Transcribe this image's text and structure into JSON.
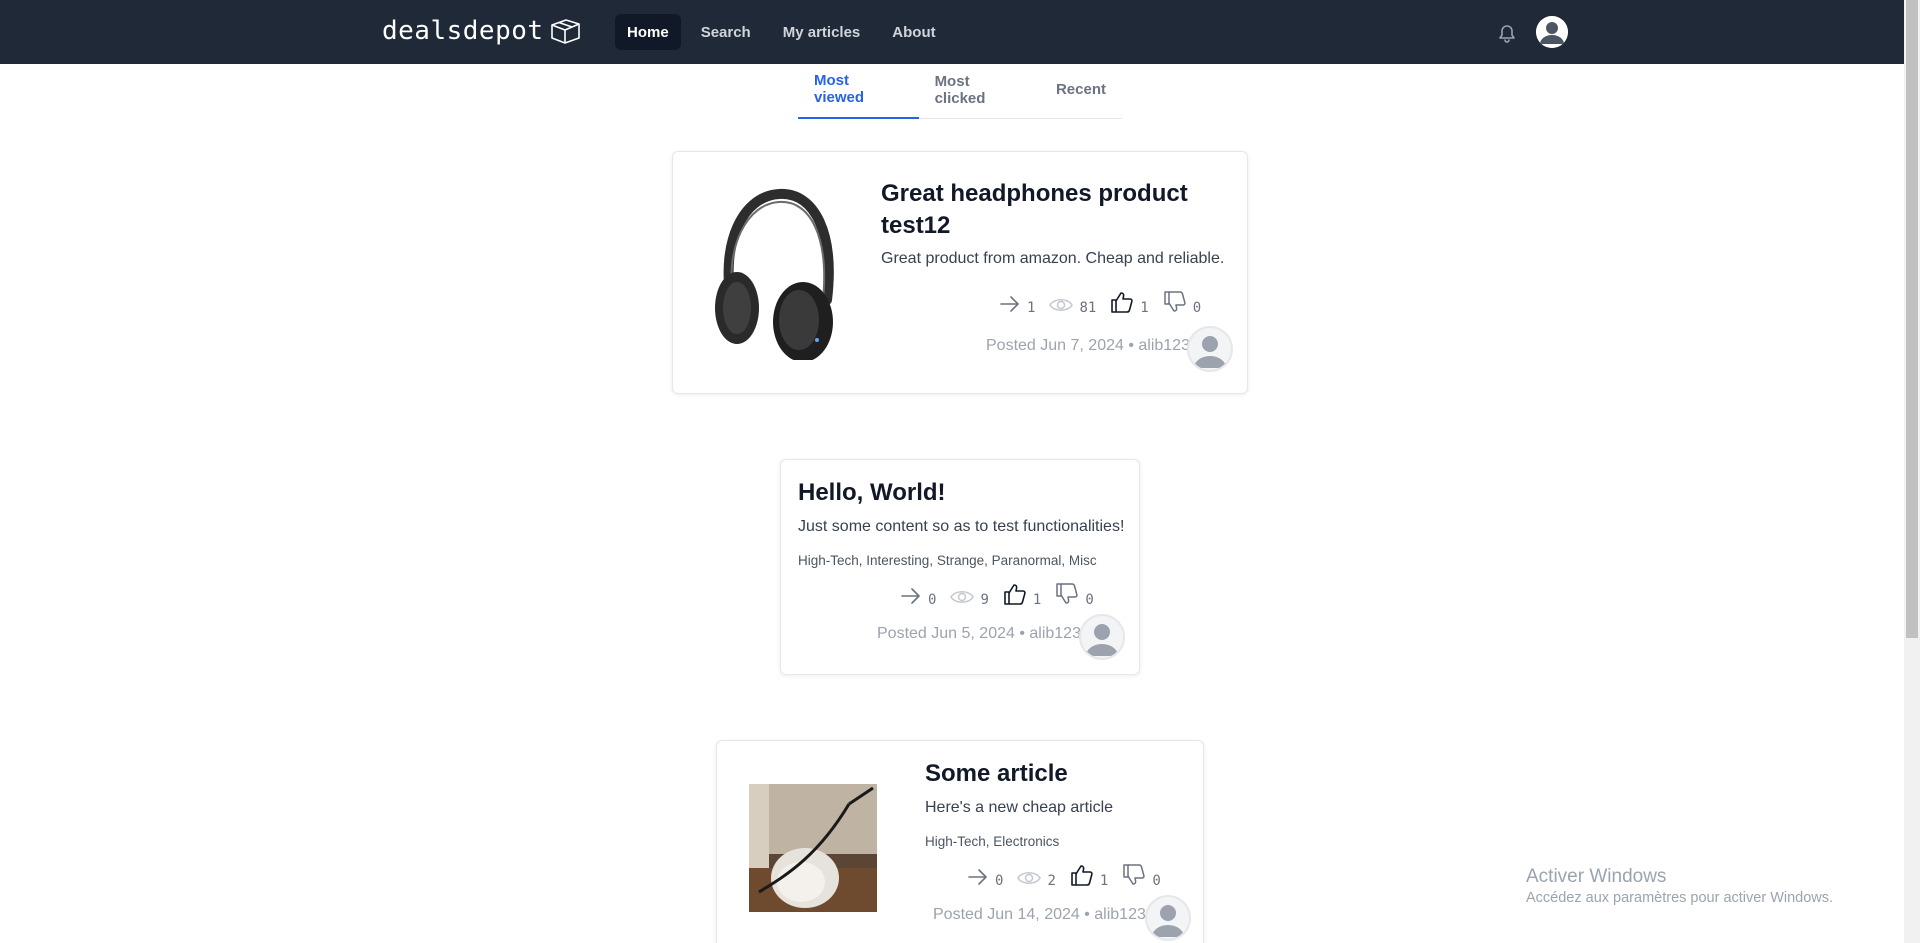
{
  "app": {
    "logo_text": "dealsdepot"
  },
  "nav": {
    "items": [
      {
        "label": "Home",
        "active": true
      },
      {
        "label": "Search",
        "active": false
      },
      {
        "label": "My articles",
        "active": false
      },
      {
        "label": "About",
        "active": false
      }
    ]
  },
  "tabs": [
    {
      "label": "Most viewed",
      "active": true
    },
    {
      "label": "Most clicked",
      "active": false
    },
    {
      "label": "Recent",
      "active": false
    }
  ],
  "articles": [
    {
      "title_line1": "Great headphones product",
      "title_line2": "test12",
      "description": "Great product from amazon. Cheap and reliable.",
      "tags": "",
      "stats": {
        "clicks": "1",
        "views": "81",
        "likes": "1",
        "dislikes": "0"
      },
      "posted": "Posted Jun 7, 2024 • alib123",
      "image": "headphones-image"
    },
    {
      "title_line1": "Hello, World!",
      "description": "Just some content so as to test functionalities!",
      "tags": "High-Tech, Interesting, Strange, Paranormal, Misc",
      "stats": {
        "clicks": "0",
        "views": "9",
        "likes": "1",
        "dislikes": "0"
      },
      "posted": "Posted Jun 5, 2024 • alib123"
    },
    {
      "title_line1": "Some article",
      "description": "Here's a new cheap article",
      "tags": "High-Tech, Electronics",
      "stats": {
        "clicks": "0",
        "views": "2",
        "likes": "1",
        "dislikes": "0"
      },
      "posted": "Posted Jun 14, 2024 • alib123",
      "image": "cat-photo"
    }
  ],
  "watermark": {
    "title": "Activer Windows",
    "subtitle": "Accédez aux paramètres pour activer Windows."
  },
  "colors": {
    "navbar": "#1f2937",
    "accent": "#2563eb"
  }
}
